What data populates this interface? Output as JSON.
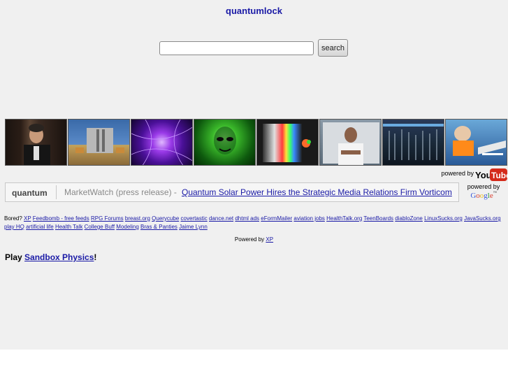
{
  "header": {
    "title": "quantumlock"
  },
  "search": {
    "value": "",
    "button_label": "search"
  },
  "thumbnails": [
    "Man in suit speaking",
    "Room with sliding door",
    "Purple particle swirl",
    "Green glowing face",
    "Spectrum light beam",
    "Man in white shirt lecturing",
    "Dark bars in blue",
    "Cartoon pilot"
  ],
  "youtube": {
    "powered_by": "powered by",
    "logo_you": "You",
    "logo_tube": "Tube"
  },
  "news": {
    "keyword": "quantum",
    "source": "MarketWatch (press release) -",
    "headline": "Quantum Solar Power Hires the Strategic Media Relations Firm Vorticom"
  },
  "google": {
    "powered_by": "powered by",
    "logo": "Google"
  },
  "links": {
    "prefix": "Bored?",
    "items": [
      "XP",
      "Feedbomb - free feeds",
      "RPG Forums",
      "breast.org",
      "Querycube",
      "covertastic",
      "dance.net",
      "dhtml ads",
      "eFormMailer",
      "aviation jobs",
      "HealthTalk.org",
      "TeenBoards",
      "diabloZone",
      "LinuxSucks.org",
      "JavaSucks.org",
      "play HQ",
      "artificial life",
      "Health Talk",
      "College Buff",
      "Modeling",
      "Bras & Panties",
      "Jaime Lynn"
    ]
  },
  "footer": {
    "powered_by": "Powered by",
    "powered_link": "XP"
  },
  "play": {
    "prefix": "Play",
    "link": "Sandbox Physics",
    "suffix": "!"
  }
}
